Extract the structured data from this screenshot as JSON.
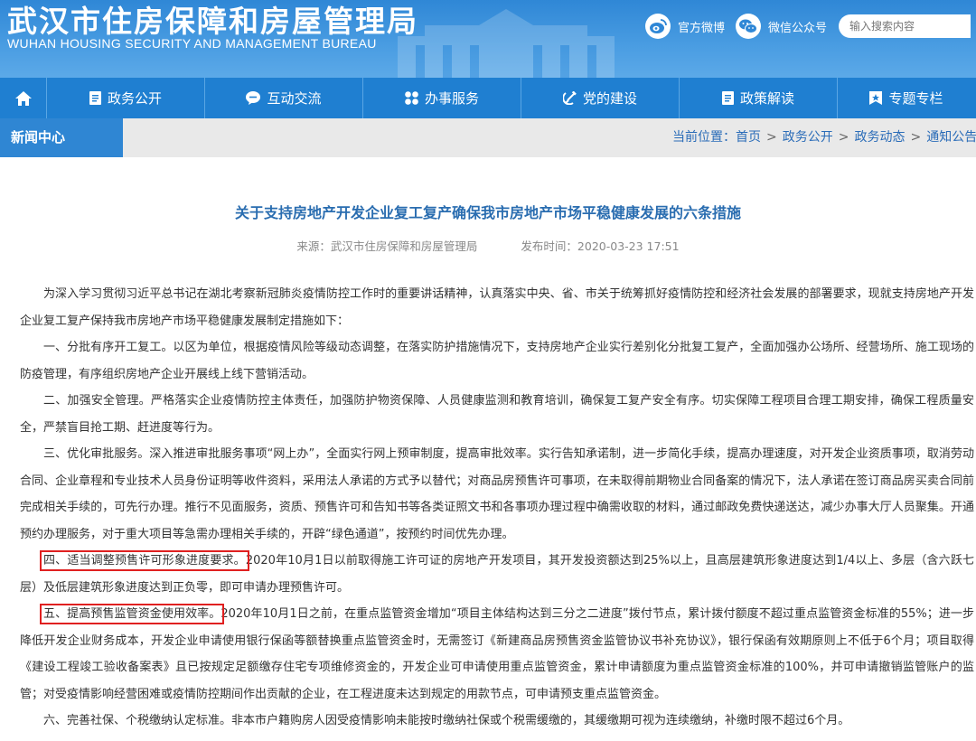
{
  "header": {
    "title_cn": "武汉市住房保障和房屋管理局",
    "title_en": "WUHAN HOUSING SECURITY AND MANAGEMENT BUREAU",
    "weibo_label": "官方微博",
    "wechat_label": "微信公众号",
    "search_placeholder": "输入搜索内容"
  },
  "nav": {
    "items": [
      {
        "label": "政务公开"
      },
      {
        "label": "互动交流"
      },
      {
        "label": "办事服务"
      },
      {
        "label": "党的建设"
      },
      {
        "label": "政策解读"
      },
      {
        "label": "专题专栏"
      }
    ]
  },
  "subbar": {
    "tab": "新闻中心",
    "crumb_prefix": "当前位置：",
    "crumbs": [
      "首页",
      "政务公开",
      "政务动态",
      "通知公告"
    ]
  },
  "article": {
    "title": "关于支持房地产开发企业复工复产确保我市房地产市场平稳健康发展的六条措施",
    "source": "来源：武汉市住房保障和房屋管理局",
    "time": "发布时间：2020-03-23 17:51",
    "intro": "为深入学习贯彻习近平总书记在湖北考察新冠肺炎疫情防控工作时的重要讲话精神，认真落实中央、省、市关于统筹抓好疫情防控和经济社会发展的部署要求，现就支持房地产开发企业复工复产保持我市房地产市场平稳健康发展制定措施如下：",
    "p1": "一、分批有序开工复工。以区为单位，根据疫情风险等级动态调整，在落实防护措施情况下，支持房地产企业实行差别化分批复工复产，全面加强办公场所、经营场所、施工现场的防疫管理，有序组织房地产企业开展线上线下营销活动。",
    "p2": "二、加强安全管理。严格落实企业疫情防控主体责任，加强防护物资保障、人员健康监测和教育培训，确保复工复产安全有序。切实保障工程项目合理工期安排，确保工程质量安全，严禁盲目抢工期、赶进度等行为。",
    "p3": "三、优化审批服务。深入推进审批服务事项“网上办”，全面实行网上预审制度，提高审批效率。实行告知承诺制，进一步简化手续，提高办理速度，对开发企业资质事项，取消劳动合同、企业章程和专业技术人员身份证明等收件资料，采用法人承诺的方式予以替代；对商品房预售许可事项，在未取得前期物业合同备案的情况下，法人承诺在签订商品房买卖合同前完成相关手续的，可先行办理。推行不见面服务，资质、预售许可和告知书等各类证照文书和各事项办理过程中确需收取的材料，通过邮政免费快递送达，减少办事大厅人员聚集。开通预约办理服务，对于重大项目等急需办理相关手续的，开辟“绿色通道”，按预约时间优先办理。",
    "p4_head": "四、适当调整预售许可形象进度要求。",
    "p4_body": "2020年10月1日以前取得施工许可证的房地产开发项目，其开发投资额达到25%以上，且高层建筑形象进度达到1/4以上、多层（含六跃七层）及低层建筑形象进度达到正负零，即可申请办理预售许可。",
    "p5_head": "五、提高预售监管资金使用效率。",
    "p5_body": "2020年10月1日之前，在重点监管资金增加“项目主体结构达到三分之二进度”拨付节点，累计拨付额度不超过重点监管资金标准的55%；进一步降低开发企业财务成本，开发企业申请使用银行保函等额替换重点监管资金时，无需签订《新建商品房预售资金监管协议书补充协议》，银行保函有效期原则上不低于6个月；项目取得《建设工程竣工验收备案表》且已按规定足额缴存住宅专项维修资金的，开发企业可申请使用重点监管资金，累计申请额度为重点监管资金标准的100%，并可申请撤销监管账户的监管；对受疫情影响经营困难或疫情防控期间作出贡献的企业，在工程进度未达到规定的用款节点，可申请预支重点监管资金。",
    "p6": "六、完善社保、个税缴纳认定标准。非本市户籍购房人因受疫情影响未能按时缴纳社保或个税需缓缴的，其缓缴期可视为连续缴纳，补缴时限不超过6个月。"
  }
}
